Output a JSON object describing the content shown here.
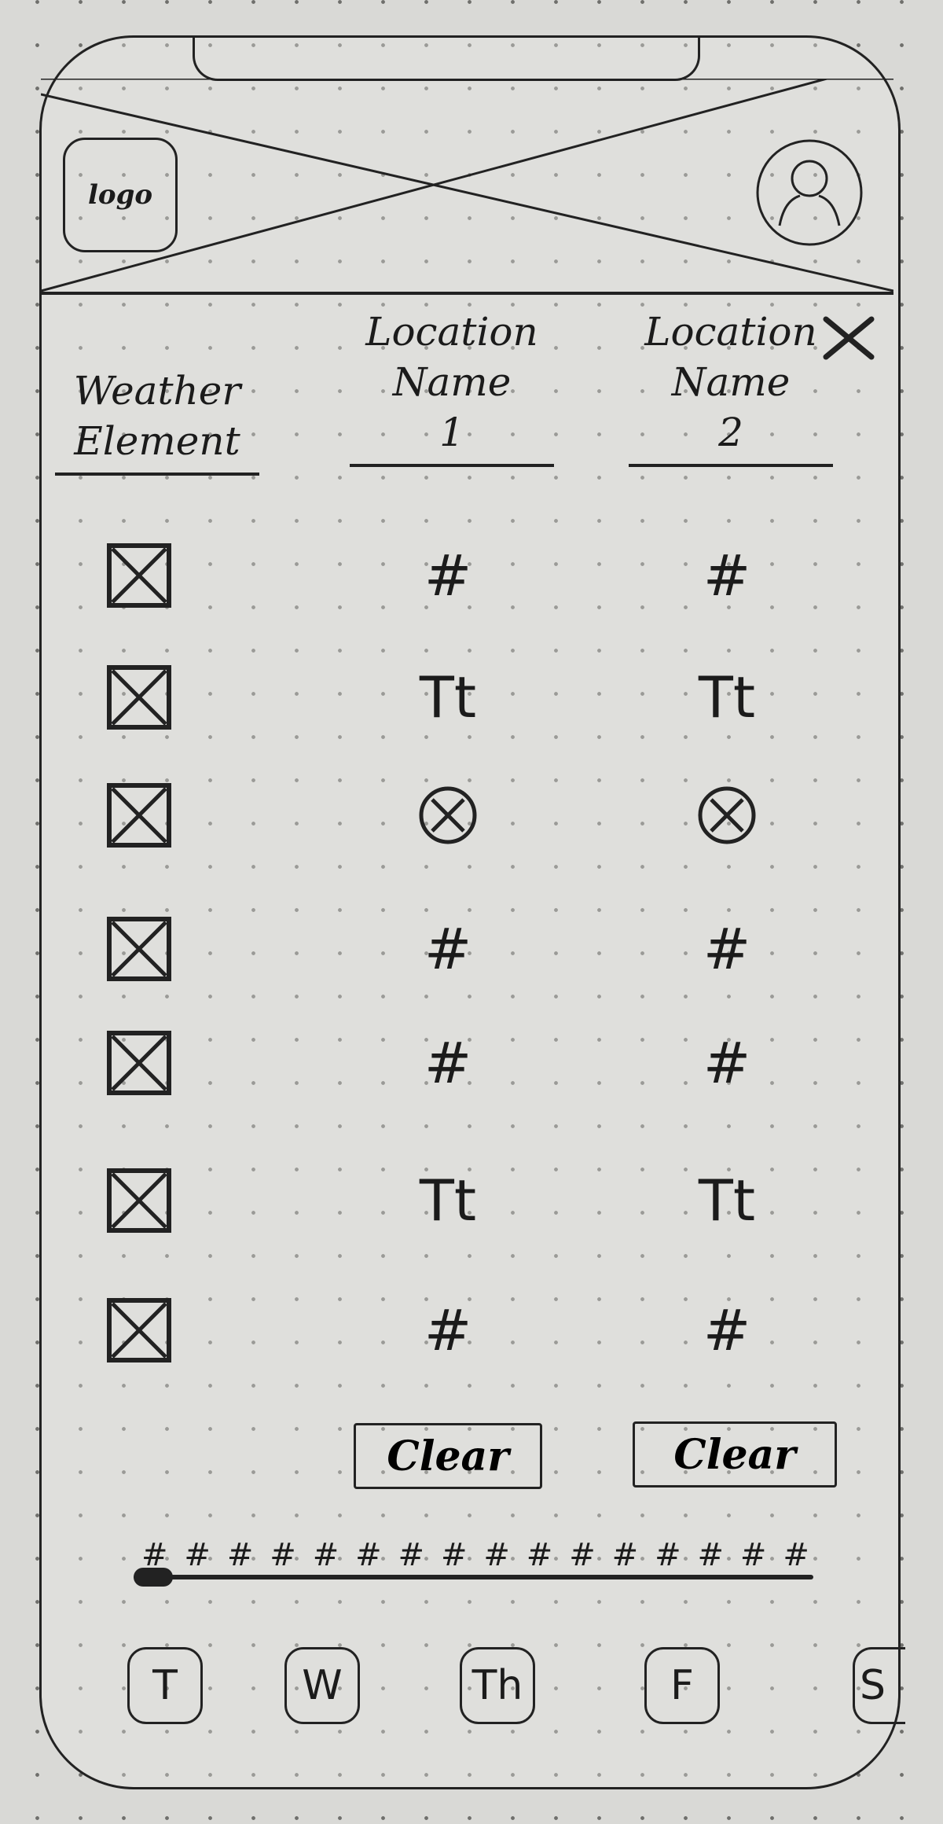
{
  "header": {
    "logo_label": "logo",
    "banner_image": "placeholder-image",
    "avatar_icon": "user-icon"
  },
  "table": {
    "first_column_header": [
      "Weather",
      "Element"
    ],
    "locations": [
      {
        "name_lines": [
          "Location",
          "Name",
          "1"
        ],
        "clear_label": "Clear"
      },
      {
        "name_lines": [
          "Location",
          "Name",
          "2"
        ],
        "clear_label": "Clear"
      }
    ],
    "remove_icon": "close-icon",
    "rows": [
      {
        "element_icon": "checkbox-checked",
        "values": [
          "#",
          "#"
        ]
      },
      {
        "element_icon": "checkbox-checked",
        "values": [
          "Tt",
          "Tt"
        ]
      },
      {
        "element_icon": "checkbox-checked",
        "values": [
          "circle-x-icon",
          "circle-x-icon"
        ]
      },
      {
        "element_icon": "checkbox-checked",
        "values": [
          "#",
          "#"
        ]
      },
      {
        "element_icon": "checkbox-checked",
        "values": [
          "#",
          "#"
        ]
      },
      {
        "element_icon": "checkbox-checked",
        "values": [
          "Tt",
          "Tt"
        ]
      },
      {
        "element_icon": "checkbox-checked",
        "values": [
          "#",
          "#"
        ]
      }
    ]
  },
  "timeline": {
    "tick_labels": [
      "#",
      "#",
      "#",
      "#",
      "#",
      "#",
      "#",
      "#",
      "#",
      "#",
      "#",
      "#",
      "#",
      "#",
      "#",
      "#"
    ],
    "position": 0
  },
  "days": [
    "T",
    "W",
    "Th",
    "F",
    "S"
  ]
}
